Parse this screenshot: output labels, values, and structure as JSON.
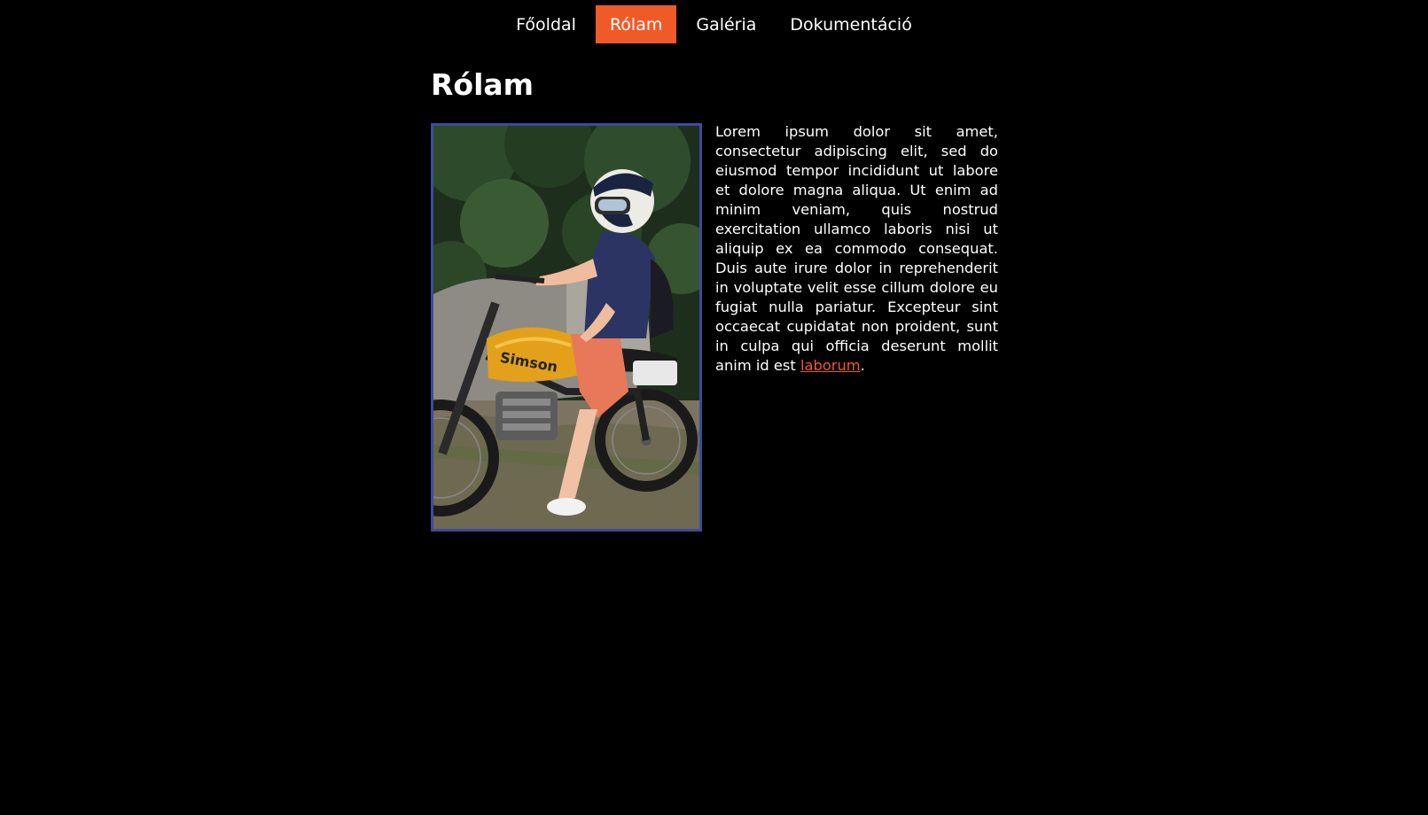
{
  "nav": {
    "items": [
      {
        "label": "Főoldal",
        "active": false
      },
      {
        "label": "Rólam",
        "active": true
      },
      {
        "label": "Galéria",
        "active": false
      },
      {
        "label": "Dokumentáció",
        "active": false
      }
    ]
  },
  "main": {
    "title": "Rólam",
    "bio_text": "Lorem ipsum dolor sit amet, consectetur adipiscing elit, sed do eiusmod tempor incididunt ut labore et dolore magna aliqua. Ut enim ad minim veniam, quis nostrud exercitation ullamco laboris nisi ut aliquip ex ea commodo consequat. Duis aute irure dolor in reprehenderit in voluptate velit esse cillum dolore eu fugiat nulla pariatur. Excepteur sint occaecat cupidatat non proident, sunt in culpa qui officia deserunt mollit anim id est ",
    "bio_link": "laborum",
    "bio_end": ".",
    "photo": {
      "tank_text": "Simson"
    }
  },
  "colors": {
    "background": "#000000",
    "accent": "#f05a28",
    "photo_border": "#3b4c9a",
    "text": "#ffffff"
  }
}
